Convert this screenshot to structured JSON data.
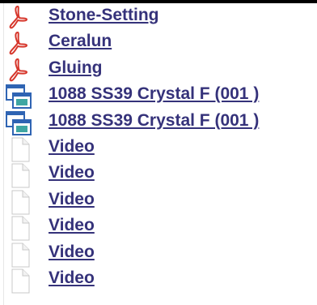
{
  "colors": {
    "link": "#35327a",
    "pdf_icon": "#d6362b",
    "video_icon_blue": "#2f64b3",
    "video_icon_teal": "#3fa6a2",
    "blank_doc_outline": "#c8c8c8"
  },
  "files": [
    {
      "icon": "pdf-icon",
      "label": "Stone-Setting"
    },
    {
      "icon": "pdf-icon",
      "label": "Ceralun"
    },
    {
      "icon": "pdf-icon",
      "label": "Gluing"
    },
    {
      "icon": "video-window-icon",
      "label": "1088 SS39 Crystal F (001 )"
    },
    {
      "icon": "video-window-icon",
      "label": "1088 SS39 Crystal F (001 )"
    },
    {
      "icon": "blank-document-icon",
      "label": "Video"
    },
    {
      "icon": "blank-document-icon",
      "label": "Video"
    },
    {
      "icon": "blank-document-icon",
      "label": "Video"
    },
    {
      "icon": "blank-document-icon",
      "label": "Video"
    },
    {
      "icon": "blank-document-icon",
      "label": "Video"
    },
    {
      "icon": "blank-document-icon",
      "label": "Video"
    }
  ]
}
